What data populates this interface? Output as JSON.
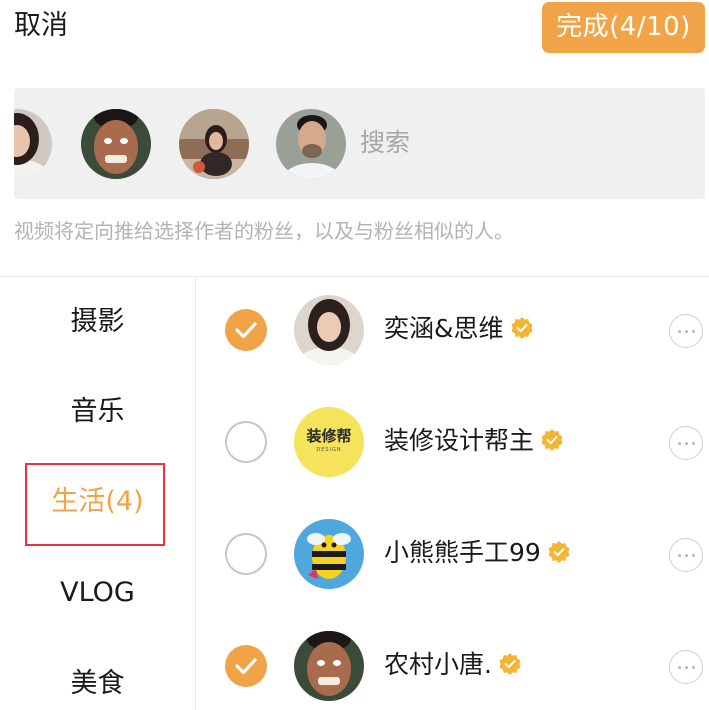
{
  "header": {
    "cancel_label": "取消",
    "done_label": "完成(4/10)"
  },
  "search": {
    "placeholder": "搜索"
  },
  "hint": "视频将定向推给选择作者的粉丝，以及与粉丝相似的人。",
  "categories": [
    {
      "label": "摄影",
      "active": false
    },
    {
      "label": "音乐",
      "active": false
    },
    {
      "label": "生活(4)",
      "active": true
    },
    {
      "label": "VLOG",
      "active": false
    },
    {
      "label": "美食",
      "active": false
    }
  ],
  "authors": [
    {
      "name": "奕涵&思维",
      "checked": true,
      "verified": true
    },
    {
      "name": "装修设计帮主",
      "checked": false,
      "verified": true,
      "logo_text": "装修帮",
      "logo_sub": "DESIGN"
    },
    {
      "name": "小熊熊手工99",
      "checked": false,
      "verified": true
    },
    {
      "name": "农村小唐.",
      "checked": true,
      "verified": true
    }
  ],
  "colors": {
    "accent": "#f0a447",
    "highlight_border": "#e8343a",
    "verified": "#f3b532"
  },
  "icons": {
    "check": "check-icon",
    "verified": "verified-badge-icon",
    "more": "more-icon"
  }
}
